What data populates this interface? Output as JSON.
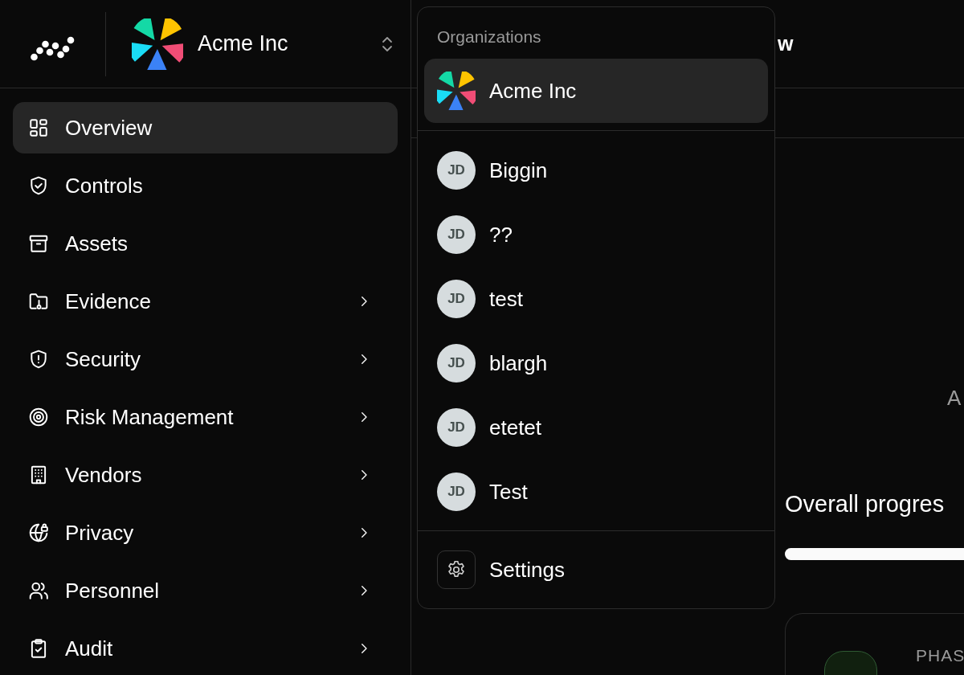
{
  "sidebar": {
    "org_switcher": {
      "name": "Acme Inc"
    },
    "nav_items": [
      {
        "label": "Overview",
        "selected": true,
        "has_submenu": false
      },
      {
        "label": "Controls",
        "selected": false,
        "has_submenu": false
      },
      {
        "label": "Assets",
        "selected": false,
        "has_submenu": false
      },
      {
        "label": "Evidence",
        "selected": false,
        "has_submenu": true
      },
      {
        "label": "Security",
        "selected": false,
        "has_submenu": true
      },
      {
        "label": "Risk Management",
        "selected": false,
        "has_submenu": true
      },
      {
        "label": "Vendors",
        "selected": false,
        "has_submenu": true
      },
      {
        "label": "Privacy",
        "selected": false,
        "has_submenu": true
      },
      {
        "label": "Personnel",
        "selected": false,
        "has_submenu": true
      },
      {
        "label": "Audit",
        "selected": false,
        "has_submenu": true
      }
    ]
  },
  "main": {
    "header": {
      "title": "w"
    },
    "content": {
      "fragment": "A",
      "progress": {
        "title": "Overall progres",
        "level": 1
      },
      "phase_card": {
        "label": "PHAS"
      }
    }
  },
  "org_menu": {
    "heading": "Organizations",
    "organizations": [
      {
        "kind": "logo",
        "name": "Acme Inc",
        "selected": true
      },
      {
        "kind": "initials",
        "initials": "JD",
        "name": "Biggin",
        "selected": false
      },
      {
        "kind": "initials",
        "initials": "JD",
        "name": "??",
        "selected": false
      },
      {
        "kind": "initials",
        "initials": "JD",
        "name": "test",
        "selected": false
      },
      {
        "kind": "initials",
        "initials": "JD",
        "name": "blargh",
        "selected": false
      },
      {
        "kind": "initials",
        "initials": "JD",
        "name": "etetet",
        "selected": false
      },
      {
        "kind": "initials",
        "initials": "JD",
        "name": "Test",
        "selected": false
      }
    ],
    "settings": {
      "label": "Settings"
    }
  }
}
